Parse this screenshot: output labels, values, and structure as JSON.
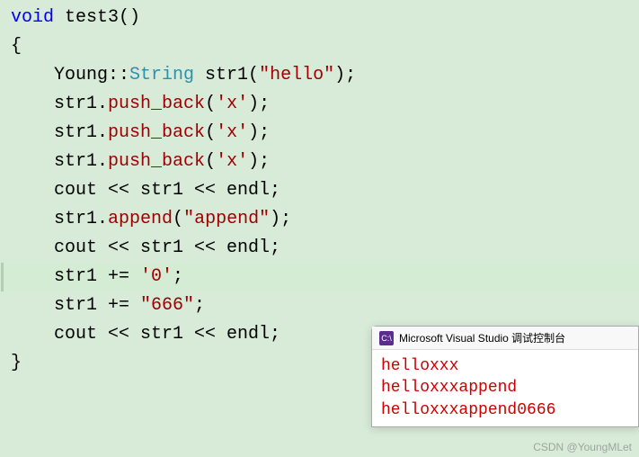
{
  "code": {
    "l1_kw": "void",
    "l1_fn": " test3()",
    "l2": "{",
    "l3_indent": "    ",
    "l3_ns": "Young::",
    "l3_type": "String",
    "l3_rest1": " str1(",
    "l3_str": "\"hello\"",
    "l3_rest2": ");",
    "l4_indent": "    ",
    "l4_obj": "str1.",
    "l4_method": "push_back",
    "l4_open": "(",
    "l4_char": "'x'",
    "l4_close": ");",
    "l5_indent": "    ",
    "l5_obj": "str1.",
    "l5_method": "push_back",
    "l5_open": "(",
    "l5_char": "'x'",
    "l5_close": ");",
    "l6_indent": "    ",
    "l6_obj": "str1.",
    "l6_method": "push_back",
    "l6_open": "(",
    "l6_char": "'x'",
    "l6_close": ");",
    "l7": "    cout << str1 << endl;",
    "l8": "",
    "l9_indent": "    ",
    "l9_obj": "str1.",
    "l9_method": "append",
    "l9_open": "(",
    "l9_str": "\"append\"",
    "l9_close": ");",
    "l10": "    cout << str1 << endl;",
    "l11": "",
    "l12_indent": "    ",
    "l12_obj": "str1 += ",
    "l12_char": "'0'",
    "l12_end": ";",
    "l13_indent": "    ",
    "l13_obj": "str1 += ",
    "l13_str": "\"666\"",
    "l13_end": ";",
    "l14": "    cout << str1 << endl;",
    "l15": "}"
  },
  "console": {
    "icon": "C:\\",
    "title": "Microsoft Visual Studio 调试控制台",
    "out1": "helloxxx",
    "out2": "helloxxxappend",
    "out3": "helloxxxappend0666"
  },
  "watermark": "CSDN @YoungMLet"
}
